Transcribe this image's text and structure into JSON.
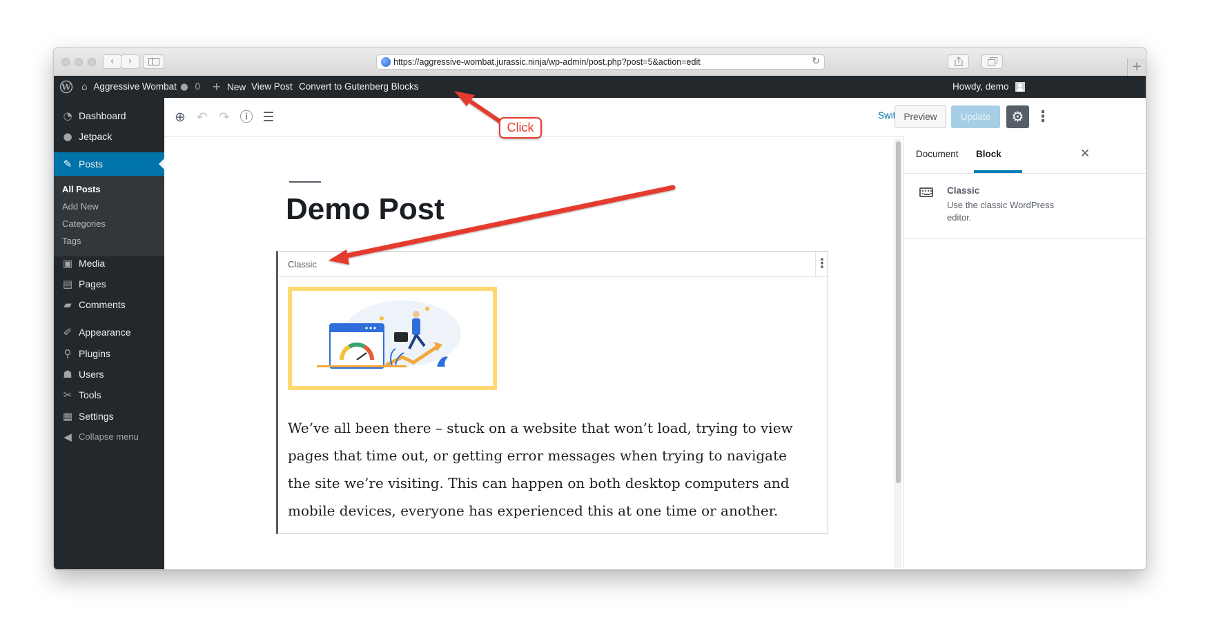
{
  "browser": {
    "url": "https://aggressive-wombat.jurassic.ninja/wp-admin/post.php?post=5&action=edit",
    "back_glyph": "‹",
    "forward_glyph": "›",
    "newtab_glyph": "+"
  },
  "admin_bar": {
    "site_name": "Aggressive Wombat",
    "comments_count": "0",
    "new_label": "New",
    "view_post_label": "View Post",
    "convert_label": "Convert to Gutenberg Blocks",
    "howdy_label": "Howdy, demo"
  },
  "sidebar": {
    "items": [
      {
        "label": "Dashboard",
        "icon": "dashboard-icon"
      },
      {
        "label": "Jetpack",
        "icon": "jetpack-icon"
      },
      {
        "label": "Posts",
        "icon": "pin-icon"
      },
      {
        "label": "Media",
        "icon": "media-icon"
      },
      {
        "label": "Pages",
        "icon": "pages-icon"
      },
      {
        "label": "Comments",
        "icon": "comments-icon"
      },
      {
        "label": "Appearance",
        "icon": "appearance-icon"
      },
      {
        "label": "Plugins",
        "icon": "plugins-icon"
      },
      {
        "label": "Users",
        "icon": "users-icon"
      },
      {
        "label": "Tools",
        "icon": "tools-icon"
      },
      {
        "label": "Settings",
        "icon": "settings-icon"
      }
    ],
    "submenu": [
      "All Posts",
      "Add New",
      "Categories",
      "Tags"
    ],
    "collapse_label": "Collapse menu"
  },
  "editor": {
    "switch_to_draft": "Switch to Draft",
    "preview": "Preview",
    "update": "Update"
  },
  "post": {
    "title": "Demo Post",
    "block_name": "Classic",
    "body": "We’ve all been there – stuck on a website that won’t load, trying to view pages that time out, or getting error messages when trying to navigate the site we’re visiting. This can happen on both desktop computers and mobile devices, everyone has experienced this at one time or another."
  },
  "settings_sidebar": {
    "tab_document": "Document",
    "tab_block": "Block",
    "block_title": "Classic",
    "block_description": "Use the classic WordPress editor."
  },
  "annotation": {
    "click_label": "Click"
  },
  "colors": {
    "admin_bar_bg": "#23282d",
    "accent_blue": "#0073aa",
    "annotation_red": "#e53b2d",
    "image_frame": "#fcd972"
  }
}
